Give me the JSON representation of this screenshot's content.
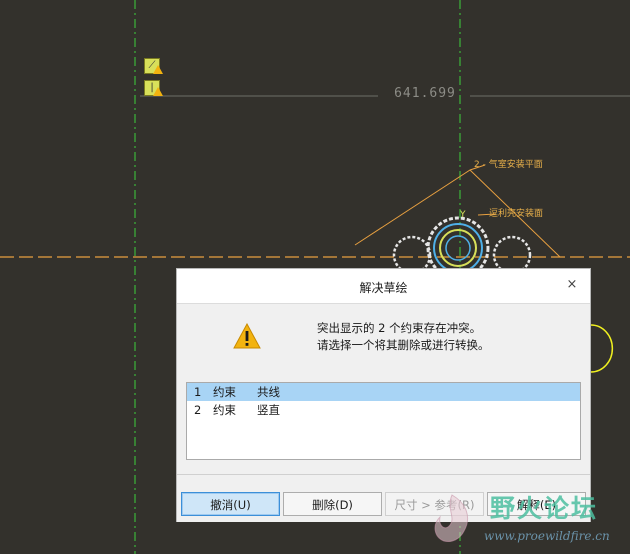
{
  "canvas": {
    "dimension_value": "641.699",
    "annotation_1": "2 - 气室安装平面",
    "annotation_2": "逗利壳安装面",
    "annotation_3": "Y",
    "icon_1": "constraint-parallel-icon",
    "icon_2": "constraint-vertical-icon"
  },
  "dialog": {
    "title": "解决草绘",
    "close_icon": "×",
    "message_line_1": "突出显示的 2 个约束存在冲突。",
    "message_line_2": "请选择一个将其删除或进行转换。",
    "warning_icon": "warning-icon",
    "constraints": [
      {
        "index": "1",
        "kind": "约束",
        "type": "共线",
        "selected": true
      },
      {
        "index": "2",
        "kind": "约束",
        "type": "竖直",
        "selected": false
      }
    ],
    "buttons": {
      "undo": "撤消(U)",
      "delete": "删除(D)",
      "dim_ref": "尺寸 > 参考(R)",
      "explain": "解释(E)"
    }
  },
  "watermark": {
    "text": "野火论坛",
    "url": "www.proewildfire.cn"
  },
  "colors": {
    "canvas_bg": "#33312c",
    "centerline_green": "#3ccf3c",
    "orange_line": "#e8a040",
    "selected_row": "#a8d4f5",
    "warning": "#f2b310"
  }
}
